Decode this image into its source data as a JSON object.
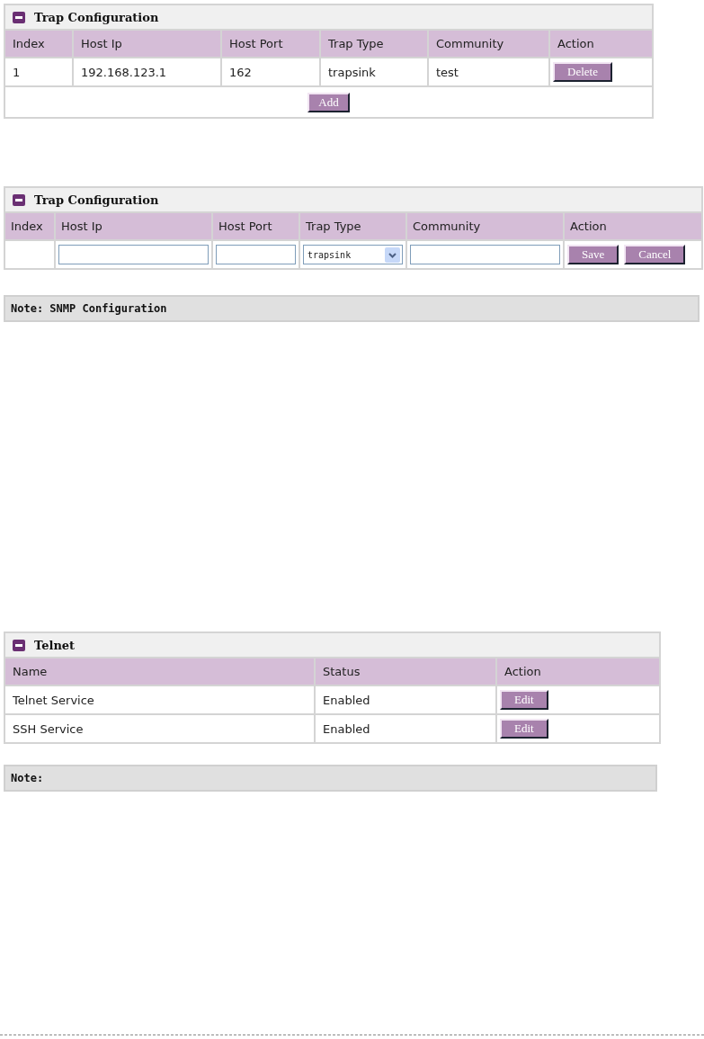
{
  "sections": [
    {
      "kind": "table",
      "title": "Trap Configuration",
      "columns": [
        "Index",
        "Host Ip",
        "Host Port",
        "Trap Type",
        "Community",
        "Action"
      ],
      "rows": [
        [
          {
            "kind": "text",
            "text": "1"
          },
          {
            "kind": "text",
            "text": "192.168.123.1"
          },
          {
            "kind": "text",
            "text": "162"
          },
          {
            "kind": "text",
            "text": "trapsink"
          },
          {
            "kind": "text",
            "text": "test"
          },
          {
            "kind": "buttons",
            "labels": [
              "Delete"
            ]
          }
        ]
      ],
      "footer_button": "Add"
    },
    {
      "kind": "table",
      "title": "Trap Configuration",
      "columns": [
        "Index",
        "Host Ip",
        "Host Port",
        "Trap Type",
        "Community",
        "Action"
      ],
      "rows": [
        [
          {
            "kind": "empty"
          },
          {
            "kind": "input"
          },
          {
            "kind": "input"
          },
          {
            "kind": "select",
            "value": "trapsink"
          },
          {
            "kind": "input"
          },
          {
            "kind": "buttons",
            "labels": [
              "Save",
              "Cancel"
            ]
          }
        ]
      ]
    },
    {
      "kind": "note",
      "text": "Note: SNMP Configuration"
    },
    {
      "kind": "table",
      "title": "Telnet",
      "columns": [
        "Name",
        "Status",
        "Action"
      ],
      "rows": [
        [
          {
            "kind": "text",
            "text": "Telnet Service"
          },
          {
            "kind": "text",
            "text": "Enabled"
          },
          {
            "kind": "buttons",
            "labels": [
              "Edit"
            ]
          }
        ],
        [
          {
            "kind": "text",
            "text": "SSH Service"
          },
          {
            "kind": "text",
            "text": "Enabled"
          },
          {
            "kind": "buttons",
            "labels": [
              "Edit"
            ]
          }
        ]
      ]
    },
    {
      "kind": "note",
      "text": "Note:"
    }
  ]
}
